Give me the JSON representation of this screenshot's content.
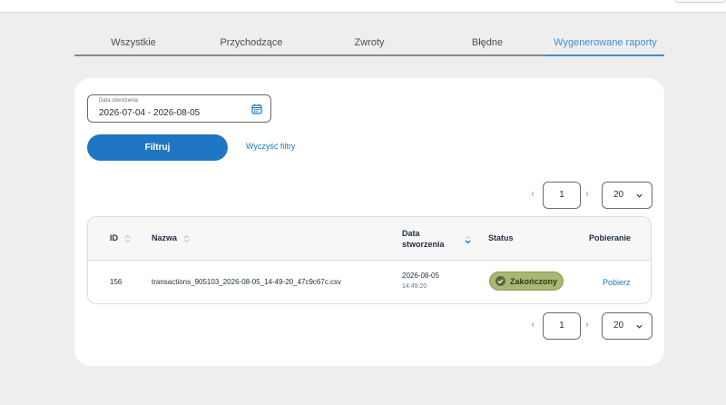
{
  "tabs": [
    {
      "label": "Wszystkie"
    },
    {
      "label": "Przychodzące"
    },
    {
      "label": "Zwroty"
    },
    {
      "label": "Błędne"
    },
    {
      "label": "Wygenerowane raporty",
      "active": true
    }
  ],
  "filters": {
    "date_label": "Data stworzenia",
    "date_value": "2026-07-04 - 2026-08-05",
    "filter_button": "Filtruj",
    "clear_link": "Wyczyść filtry"
  },
  "pagination": {
    "prev": "‹",
    "next": "›",
    "page": "1",
    "page_size": "20"
  },
  "table": {
    "headers": {
      "id": "ID",
      "name": "Nazwa",
      "date_line1": "Data",
      "date_line2": "stworzenia",
      "status": "Status",
      "download": "Pobieranie"
    },
    "rows": [
      {
        "id": "156",
        "name": "transactions_905103_2026-08-05_14-49-20_47c9c67c.csv",
        "date": "2026-08-05",
        "time": "14:49:20",
        "status": "Zakończony",
        "download": "Pobierz"
      }
    ]
  },
  "colors": {
    "accent": "#1f76c2",
    "tab_active": "#3d8fd6",
    "status_success": "#a8b874"
  }
}
